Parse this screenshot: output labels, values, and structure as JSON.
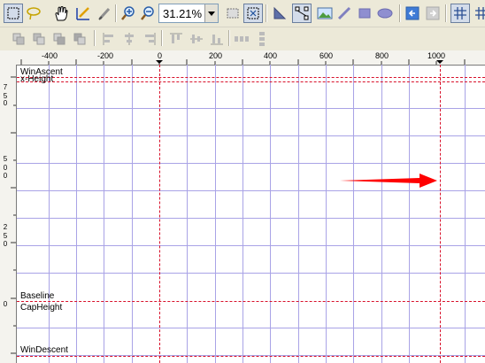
{
  "toolbar": {
    "zoom": "31.21%",
    "tools": [
      "select-rect-icon",
      "lasso-icon",
      "hand-icon",
      "pen-icon",
      "brush-icon",
      "zoom-in-icon",
      "zoom-out-icon"
    ],
    "shapes": [
      "triangle-icon",
      "node-icon",
      "image-icon",
      "pencil-icon",
      "rectangle-icon",
      "ellipse-icon",
      "arrow-back-icon",
      "arrow-forward-icon",
      "grid-icon",
      "grid-plus-icon"
    ]
  },
  "ruler": {
    "horizontal_labels": [
      "-400",
      "-200",
      "0",
      "200",
      "400",
      "600",
      "800",
      "1000"
    ],
    "vertical_labels": [
      [
        "7",
        "5",
        "0"
      ],
      [
        "5",
        "0",
        "0"
      ],
      [
        "2",
        "5",
        "0"
      ],
      [
        "0"
      ]
    ]
  },
  "metrics": {
    "win_ascent": "WinAscent",
    "x_height": "x-Height",
    "baseline": "Baseline",
    "cap_height": "CapHeight",
    "win_descent": "WinDescent"
  },
  "colors": {
    "grid": "#a9a3e6",
    "metric_line": "#d8102a",
    "arrow": "#ff0000"
  }
}
